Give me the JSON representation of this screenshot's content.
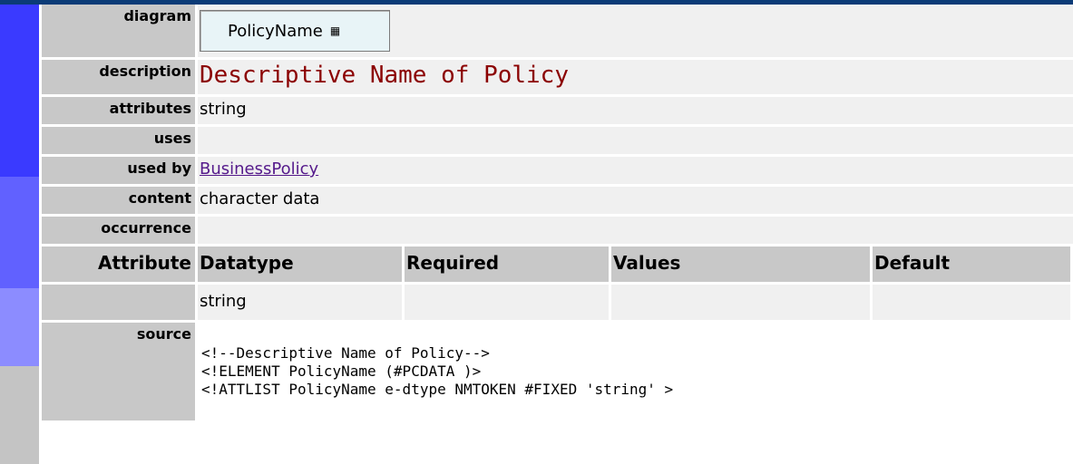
{
  "labels": {
    "diagram": "diagram",
    "description": "description",
    "attributes": "attributes",
    "uses": "uses",
    "used_by": "used by",
    "content": "content",
    "occurrence": "occurrence",
    "attribute": "Attribute",
    "source": "source"
  },
  "diagram": {
    "element_name": "PolicyName",
    "icon": "sequence-grid-icon"
  },
  "description": "Descriptive Name of Policy",
  "attributes_value": "string",
  "uses_value": "",
  "used_by_link": "BusinessPolicy",
  "content_value": "character data",
  "occurrence_value": "",
  "attribute_table": {
    "headers": [
      "Datatype",
      "Required",
      "Values",
      "Default"
    ],
    "rows": [
      {
        "attribute": "",
        "datatype": "string",
        "required": "",
        "values": "",
        "default": ""
      }
    ]
  },
  "source_lines": [
    "<!--Descriptive Name of Policy-->",
    "<!ELEMENT PolicyName (#PCDATA )>",
    "<!ATTLIST PolicyName e-dtype NMTOKEN #FIXED 'string' >"
  ],
  "colors": {
    "top_bar": "#0b3b77",
    "left_bar_1": "#3a3aff",
    "left_bar_2": "#6161ff",
    "left_bar_3": "#8c8cff",
    "left_bar_4": "#c4c4c4",
    "description_text": "#8b0000",
    "link": "#551a8b"
  }
}
